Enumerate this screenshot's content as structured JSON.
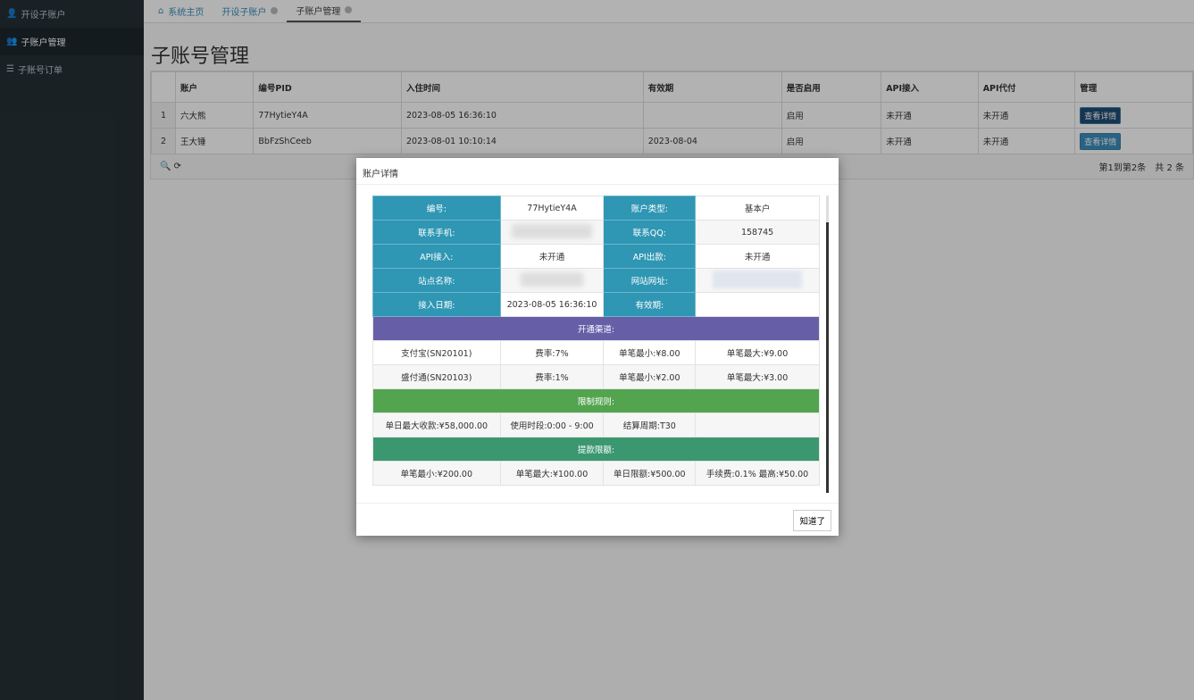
{
  "sidebar": {
    "items": [
      {
        "label": "开设子账户"
      },
      {
        "label": "子账户管理"
      },
      {
        "label": "子账号订单"
      }
    ]
  },
  "tabs": [
    {
      "label": "系统主页"
    },
    {
      "label": "开设子账户"
    },
    {
      "label": "子账户管理"
    }
  ],
  "page_title": "子账号管理",
  "table": {
    "headers": [
      "账户",
      "编号PID",
      "入住时间",
      "有效期",
      "是否启用",
      "API接入",
      "API代付",
      "管理"
    ],
    "rows": [
      {
        "idx": "1",
        "account": "六大熊",
        "pid": "77HytieY4A",
        "joined": "2023-08-05 16:36:10",
        "valid": "",
        "enabled": "启用",
        "api_in": "未开通",
        "api_pay": "未开通",
        "action": "查看详情"
      },
      {
        "idx": "2",
        "account": "王大锤",
        "pid": "BbFzShCeeb",
        "joined": "2023-08-01 10:10:14",
        "valid": "2023-08-04",
        "enabled": "启用",
        "api_in": "未开通",
        "api_pay": "未开通",
        "action": "查看详情"
      }
    ],
    "pagination": "第1到第2条　共 2 条"
  },
  "modal": {
    "title": "账户详情",
    "info": [
      [
        "编号:",
        "77HytieY4A",
        "账户类型:",
        "基本户"
      ],
      [
        "联系手机:",
        "",
        "联系QQ:",
        "158745"
      ],
      [
        "API接入:",
        "未开通",
        "API出款:",
        "未开通"
      ],
      [
        "站点名称:",
        "",
        "网站网址:",
        ""
      ],
      [
        "接入日期:",
        "2023-08-05 16:36:10",
        "有效期:",
        ""
      ]
    ],
    "channels_header": "开通渠道:",
    "channels": [
      [
        "支付宝(SN20101)",
        "费率:7%",
        "单笔最小:¥8.00",
        "单笔最大:¥9.00"
      ],
      [
        "盛付通(SN20103)",
        "费率:1%",
        "单笔最小:¥2.00",
        "单笔最大:¥3.00"
      ]
    ],
    "limits_header": "限制规则:",
    "limits": [
      "单日最大收款:¥58,000.00",
      "使用时段:0:00 - 9:00",
      "结算周期:T30",
      ""
    ],
    "withdraw_header": "提款限额:",
    "withdraw": [
      "单笔最小:¥200.00",
      "单笔最大:¥100.00",
      "单日限额:¥500.00",
      "手续费:0.1% 最高:¥50.00"
    ],
    "ok_label": "知道了"
  },
  "colors": {
    "label": "#2f96b4",
    "channels": "#665fa8",
    "limits": "#52a44f",
    "withdraw": "#3a9770"
  }
}
